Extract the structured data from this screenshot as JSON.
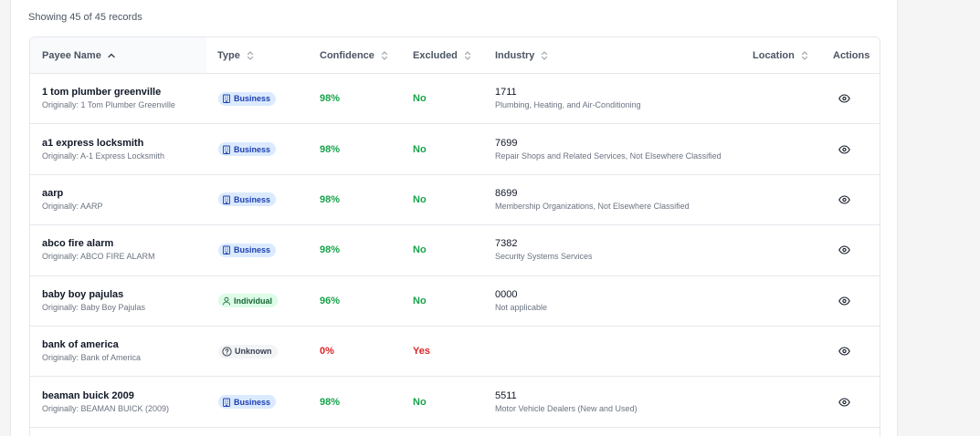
{
  "summary": "Showing 45 of 45 records",
  "columns": {
    "payee": "Payee Name",
    "type": "Type",
    "confidence": "Confidence",
    "excluded": "Excluded",
    "industry": "Industry",
    "location": "Location",
    "actions": "Actions"
  },
  "rows": [
    {
      "name": "1 tom plumber greenville",
      "original": "Originally: 1 Tom Plumber Greenville",
      "type": "Business",
      "type_icon": "building-icon",
      "confidence": "98%",
      "excluded": "No",
      "code": "1711",
      "description": "Plumbing, Heating, and Air-Conditioning"
    },
    {
      "name": "a1 express locksmith",
      "original": "Originally: A-1 Express Locksmith",
      "type": "Business",
      "type_icon": "building-icon",
      "confidence": "98%",
      "excluded": "No",
      "code": "7699",
      "description": "Repair Shops and Related Services, Not Elsewhere Classified"
    },
    {
      "name": "aarp",
      "original": "Originally: AARP",
      "type": "Business",
      "type_icon": "building-icon",
      "confidence": "98%",
      "excluded": "No",
      "code": "8699",
      "description": "Membership Organizations, Not Elsewhere Classified"
    },
    {
      "name": "abco fire alarm",
      "original": "Originally: ABCO FIRE ALARM",
      "type": "Business",
      "type_icon": "building-icon",
      "confidence": "98%",
      "excluded": "No",
      "code": "7382",
      "description": "Security Systems Services"
    },
    {
      "name": "baby boy pajulas",
      "original": "Originally: Baby Boy Pajulas",
      "type": "Individual",
      "type_icon": "person-icon",
      "confidence": "96%",
      "excluded": "No",
      "code": "0000",
      "description": "Not applicable"
    },
    {
      "name": "bank of america",
      "original": "Originally: Bank of America",
      "type": "Unknown",
      "type_icon": "question-circle-icon",
      "confidence": "0%",
      "excluded": "Yes",
      "code": "",
      "description": ""
    },
    {
      "name": "beaman buick 2009",
      "original": "Originally: BEAMAN BUICK (2009)",
      "type": "Business",
      "type_icon": "building-icon",
      "confidence": "98%",
      "excluded": "No",
      "code": "5511",
      "description": "Motor Vehicle Dealers (New and Used)"
    }
  ],
  "colors": {
    "green": "#16a34a",
    "red": "#dc2626",
    "business_bg": "#dbeafe",
    "individual_bg": "#dcfce7",
    "unknown_bg": "#f3f4f6"
  }
}
